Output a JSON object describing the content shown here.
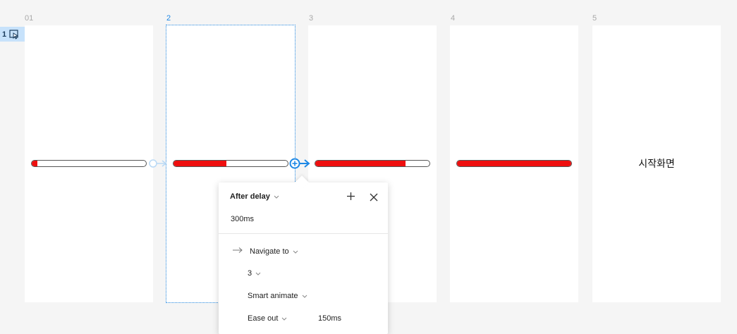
{
  "flow_badge": {
    "number": "1",
    "icon": "flow-start-icon"
  },
  "frames": [
    {
      "label": "01",
      "progress": 0.05
    },
    {
      "label": "2",
      "progress": 0.46
    },
    {
      "label": "3",
      "progress": 0.79
    },
    {
      "label": "4",
      "progress": 1.0
    },
    {
      "label": "5",
      "text": "시작화면"
    }
  ],
  "popover": {
    "trigger": "After delay",
    "delay": "300ms",
    "action": "Navigate to",
    "destination": "3",
    "animation": "Smart animate",
    "easing": "Ease out",
    "duration": "150ms",
    "add_icon": "plus-icon",
    "close_icon": "close-icon",
    "action_icon": "arrow-right-icon"
  },
  "colors": {
    "progress_fill": "#ee0f0f",
    "selection": "#2a8ee6",
    "badge_bg": "#c7e2fb"
  }
}
